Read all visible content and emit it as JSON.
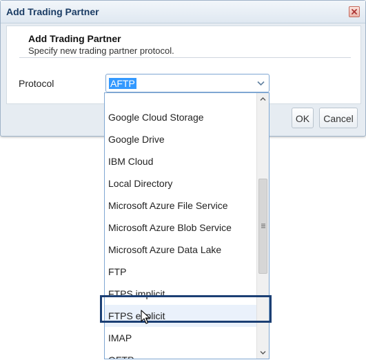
{
  "dialog": {
    "title": "Add Trading Partner",
    "header_title": "Add Trading Partner",
    "header_subtitle": "Specify new trading partner protocol.",
    "protocol_label": "Protocol",
    "protocol_value": "AFTP",
    "ok_label": "OK",
    "cancel_label": "Cancel"
  },
  "dropdown": {
    "items": [
      "Google Cloud Storage",
      "Google Drive",
      "IBM Cloud",
      "Local Directory",
      "Microsoft Azure File Service",
      "Microsoft Azure Blob Service",
      "Microsoft Azure Data Lake",
      "FTP",
      "FTPS implicit",
      "FTPS explicit",
      "IMAP",
      "OFTP"
    ],
    "hovered_item": "FTPS explicit"
  },
  "colors": {
    "title_text": "#1a3c64",
    "selection_bg": "#3399ff",
    "highlight_border": "#1b3f74"
  }
}
